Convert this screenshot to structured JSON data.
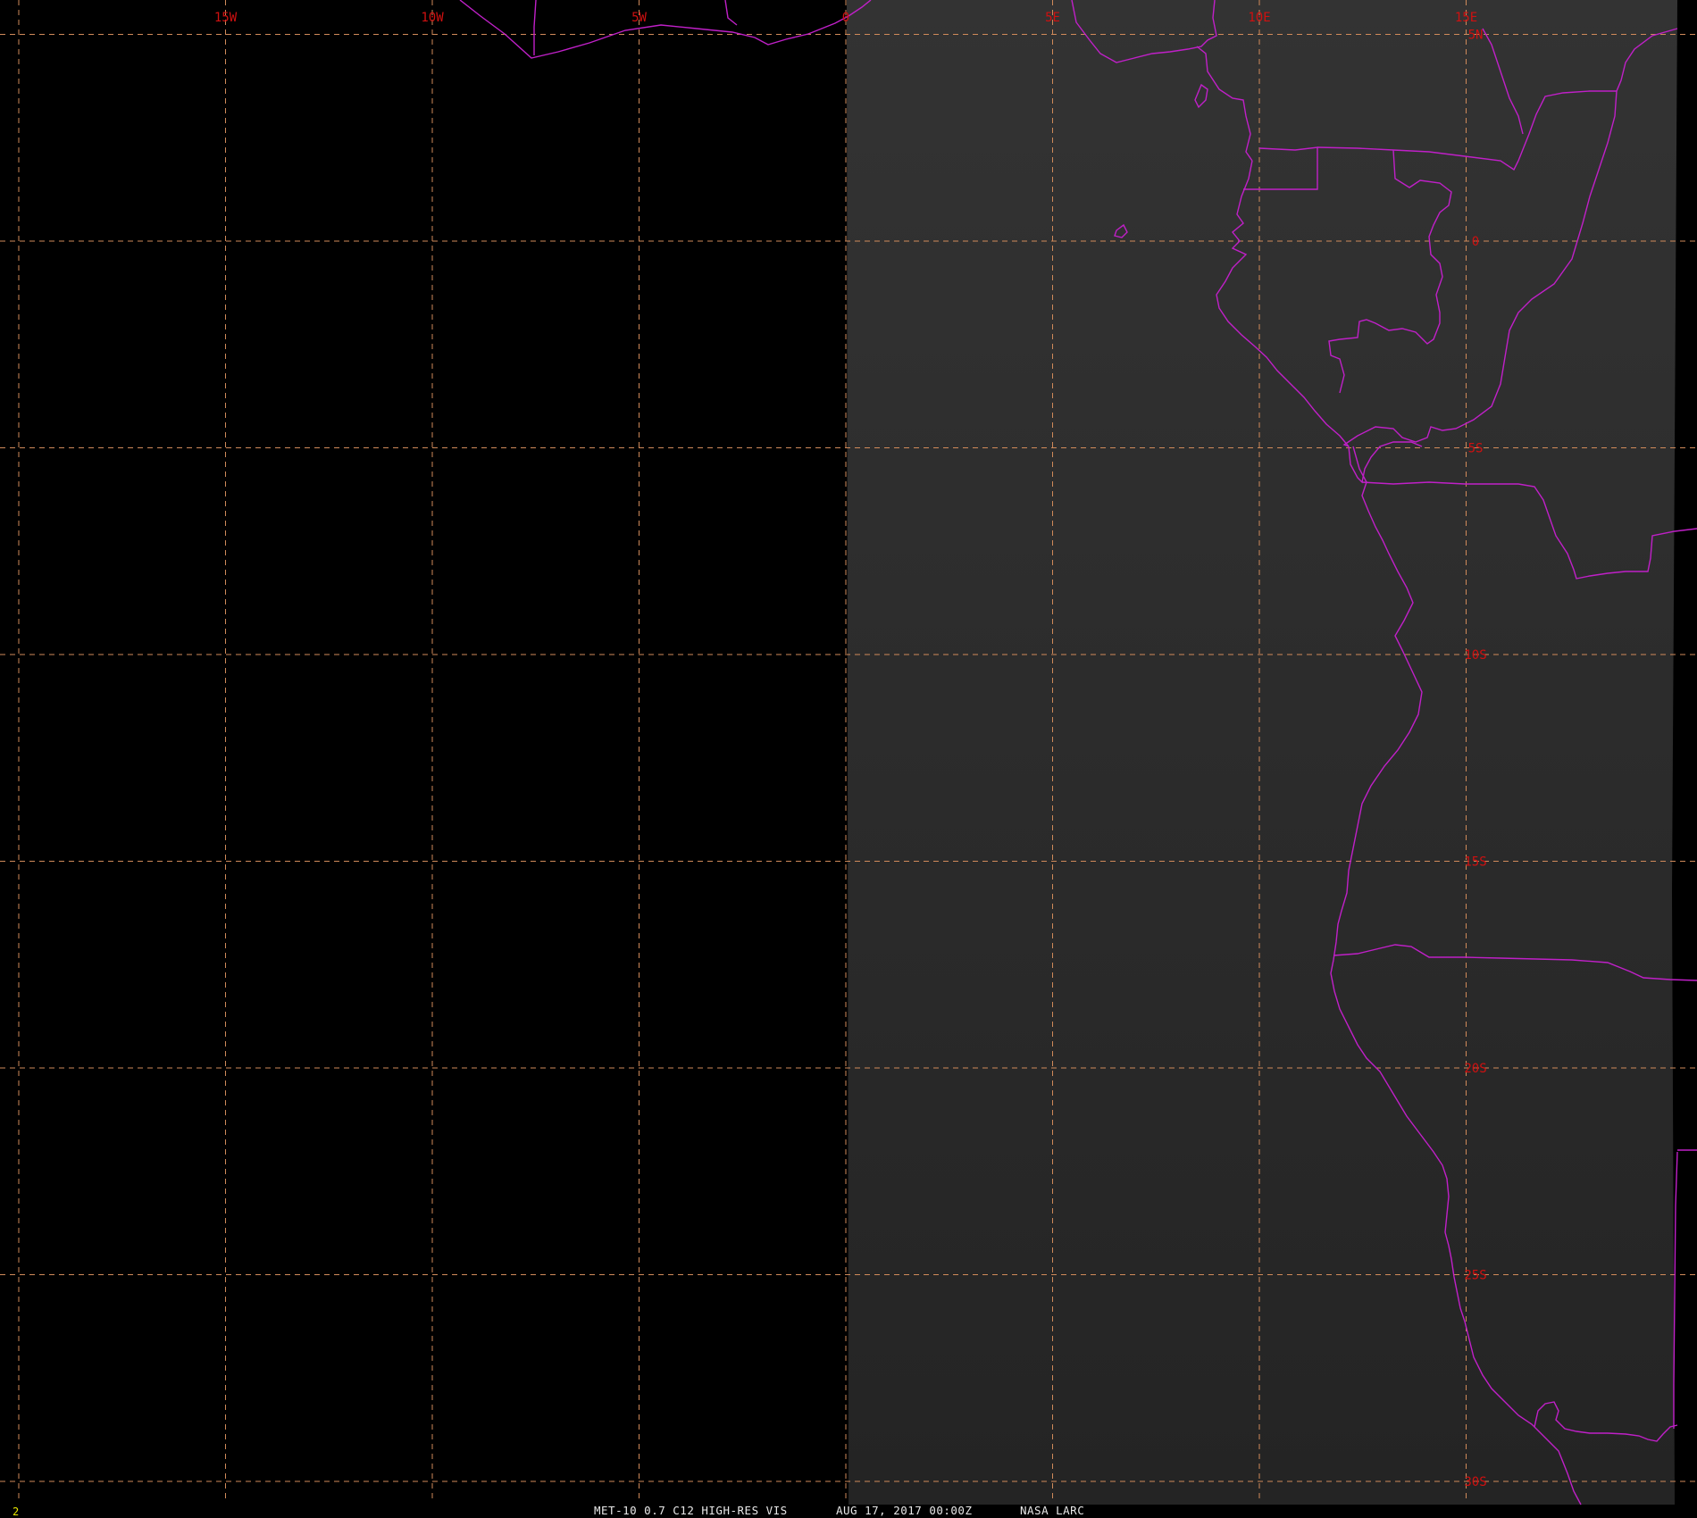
{
  "image": {
    "satellite_caption": "MET-10 0.7 C12 HIGH-RES VIS",
    "timestamp": "AUG 17, 2017 00:00Z",
    "source": "NASA LARC",
    "frame_number": "2"
  },
  "graticule": {
    "line_color": "#d08a5a",
    "label_color": "#d01010",
    "longitudes": [
      {
        "value": -20,
        "label": ""
      },
      {
        "value": -15,
        "label": "15W"
      },
      {
        "value": -10,
        "label": "10W"
      },
      {
        "value": -5,
        "label": "5W"
      },
      {
        "value": 0,
        "label": "0"
      },
      {
        "value": 5,
        "label": "5E"
      },
      {
        "value": 10,
        "label": "10E"
      },
      {
        "value": 15,
        "label": "15E"
      }
    ],
    "latitudes": [
      {
        "value": 5,
        "label": "5N"
      },
      {
        "value": 0,
        "label": "0"
      },
      {
        "value": -5,
        "label": "5S"
      },
      {
        "value": -10,
        "label": "10S"
      },
      {
        "value": -15,
        "label": "15S"
      },
      {
        "value": -20,
        "label": "20S"
      },
      {
        "value": -25,
        "label": "25S"
      },
      {
        "value": -30,
        "label": "30S"
      }
    ]
  },
  "colors": {
    "background": "#000000",
    "daylit_region": "#2a2a2a",
    "boundaries": "#c020c8"
  }
}
